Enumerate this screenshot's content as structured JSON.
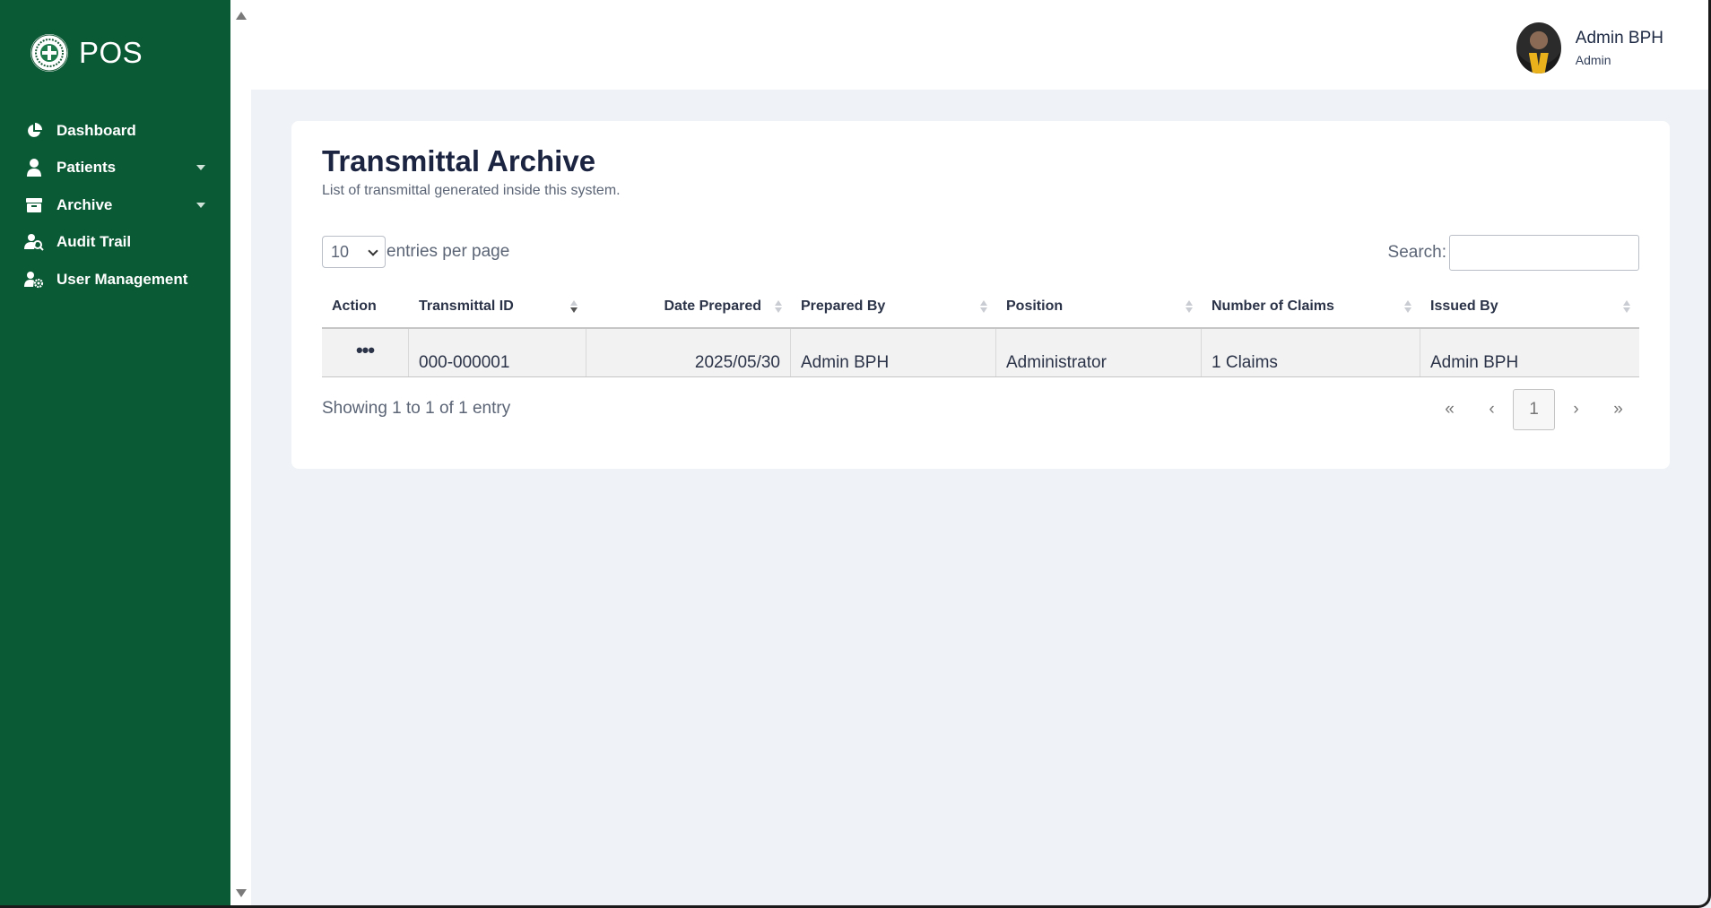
{
  "brand": {
    "name": "POS"
  },
  "sidebar": {
    "items": [
      {
        "label": "Dashboard",
        "icon": "pie-chart-icon"
      },
      {
        "label": "Patients",
        "icon": "person-icon",
        "has_caret": true
      },
      {
        "label": "Archive",
        "icon": "archive-box-icon",
        "has_caret": true
      },
      {
        "label": "Audit Trail",
        "icon": "user-search-icon"
      },
      {
        "label": "User Management",
        "icon": "users-gear-icon"
      }
    ]
  },
  "header": {
    "user_name": "Admin BPH",
    "user_role": "Admin"
  },
  "page": {
    "title": "Transmittal Archive",
    "subtitle": "List of transmittal generated inside this system."
  },
  "controls": {
    "entries_value": "10",
    "entries_label": "entries per page",
    "search_label": "Search:",
    "search_value": ""
  },
  "table": {
    "columns": [
      "Action",
      "Transmittal ID",
      "Date Prepared",
      "Prepared By",
      "Position",
      "Number of Claims",
      "Issued By"
    ],
    "rows": [
      {
        "action": "•••",
        "transmittal_id": "000-000001",
        "date_prepared": "2025/05/30",
        "prepared_by": "Admin BPH",
        "position": "Administrator",
        "number_of_claims": "1 Claims",
        "issued_by": "Admin BPH"
      }
    ]
  },
  "footer": {
    "info": "Showing 1 to 1 of 1 entry",
    "pagination": {
      "first": "«",
      "prev": "‹",
      "current": "1",
      "next": "›",
      "last": "»"
    }
  },
  "colors": {
    "sidebar": "#0b5a36",
    "background": "#eff2f6",
    "card": "#ffffff"
  }
}
